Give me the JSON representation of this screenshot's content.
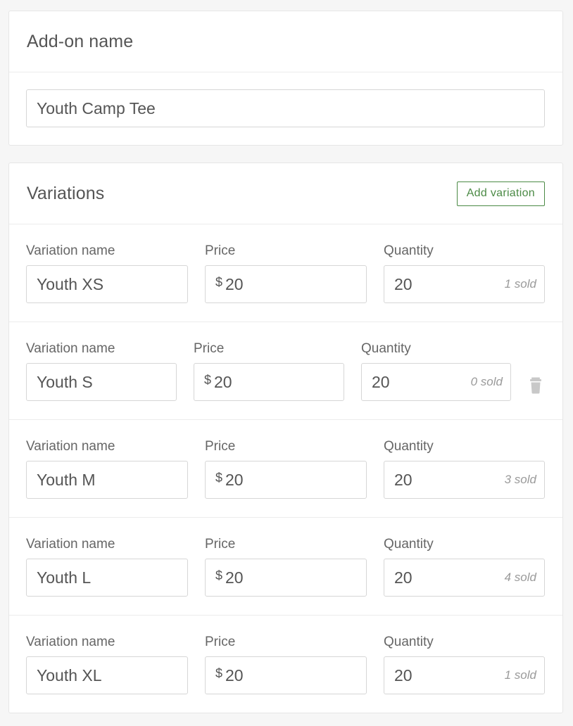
{
  "addon": {
    "title": "Add-on name",
    "name_value": "Youth Camp Tee"
  },
  "variations": {
    "title": "Variations",
    "add_button_label": "Add variation",
    "labels": {
      "name": "Variation name",
      "price": "Price",
      "quantity": "Quantity"
    },
    "currency_symbol": "$",
    "delete_icon": "trash-icon",
    "accent_color": "#4b8a45",
    "items": [
      {
        "name": "Youth XS",
        "price": "20",
        "quantity": "20",
        "sold": "1 sold"
      },
      {
        "name": "Youth S",
        "price": "20",
        "quantity": "20",
        "sold": "0 sold"
      },
      {
        "name": "Youth M",
        "price": "20",
        "quantity": "20",
        "sold": "3 sold"
      },
      {
        "name": "Youth L",
        "price": "20",
        "quantity": "20",
        "sold": "4 sold"
      },
      {
        "name": "Youth XL",
        "price": "20",
        "quantity": "20",
        "sold": "1 sold"
      }
    ]
  }
}
